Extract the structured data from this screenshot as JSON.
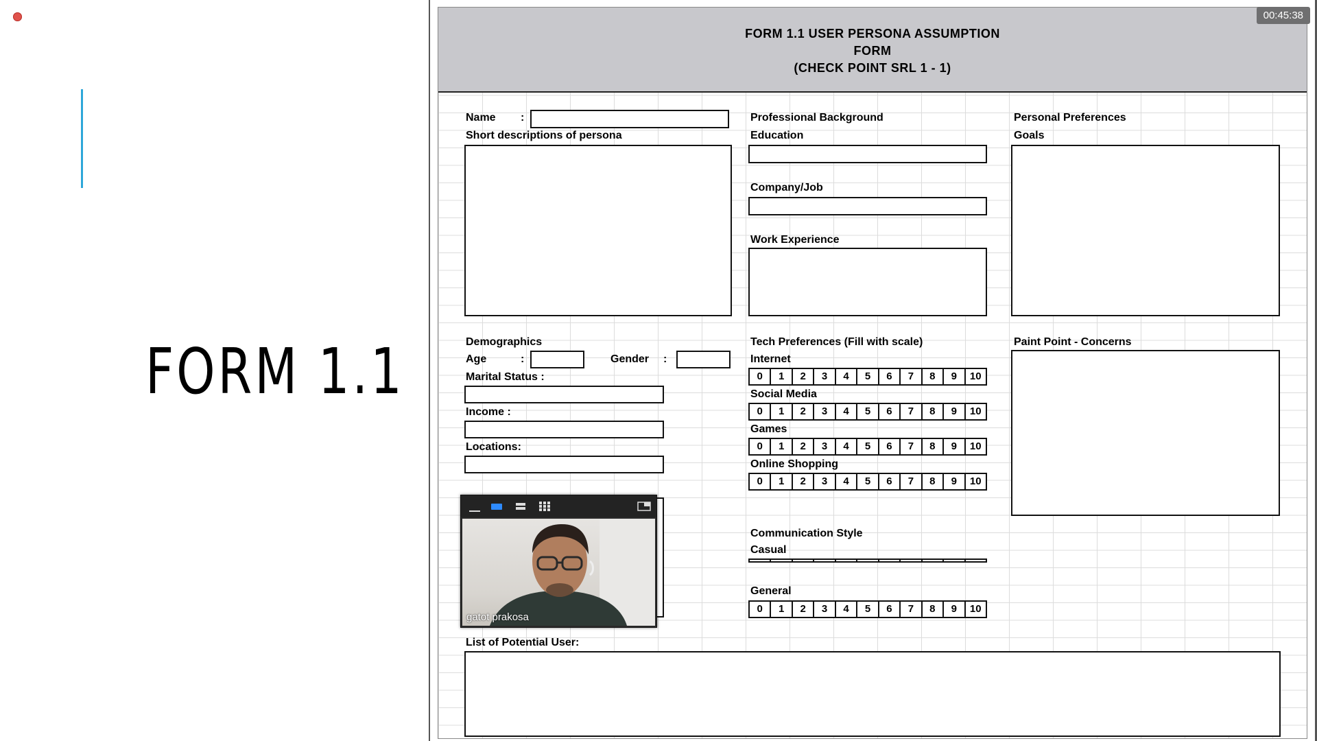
{
  "slide": {
    "title": "FORM 1.1"
  },
  "timer": "00:45:38",
  "form": {
    "header": [
      "FORM 1.1 USER PERSONA ASSUMPTION",
      "FORM",
      "(CHECK POINT SRL 1 - 1)"
    ],
    "name_label": "Name",
    "short_desc_label": "Short descriptions of persona",
    "professional_background": "Professional Background",
    "education": "Education",
    "company_job": "Company/Job",
    "work_experience": "Work Experience",
    "personal_preferences": "Personal Preferences",
    "goals": "Goals",
    "demographics": "Demographics",
    "age": "Age",
    "gender": "Gender",
    "marital_status": "Marital Status :",
    "income": "Income :",
    "locations": "Locations:",
    "tech_preferences": "Tech Preferences (Fill with scale)",
    "internet": "Internet",
    "social_media": "Social Media",
    "games": "Games",
    "online_shopping": "Online Shopping",
    "communication_style": "Communication Style",
    "casual": "Casual",
    "general": "General",
    "pain_point": "Paint Point - Concerns",
    "list_potential": "List of Potential User:",
    "scale": [
      "0",
      "1",
      "2",
      "3",
      "4",
      "5",
      "6",
      "7",
      "8",
      "9",
      "10"
    ]
  },
  "video": {
    "participant_name": "gatot prakosa"
  },
  "colors": {
    "header_band": "#c8c8cc",
    "accent_line": "#2da7d9",
    "rec_dot": "#e0534c"
  }
}
